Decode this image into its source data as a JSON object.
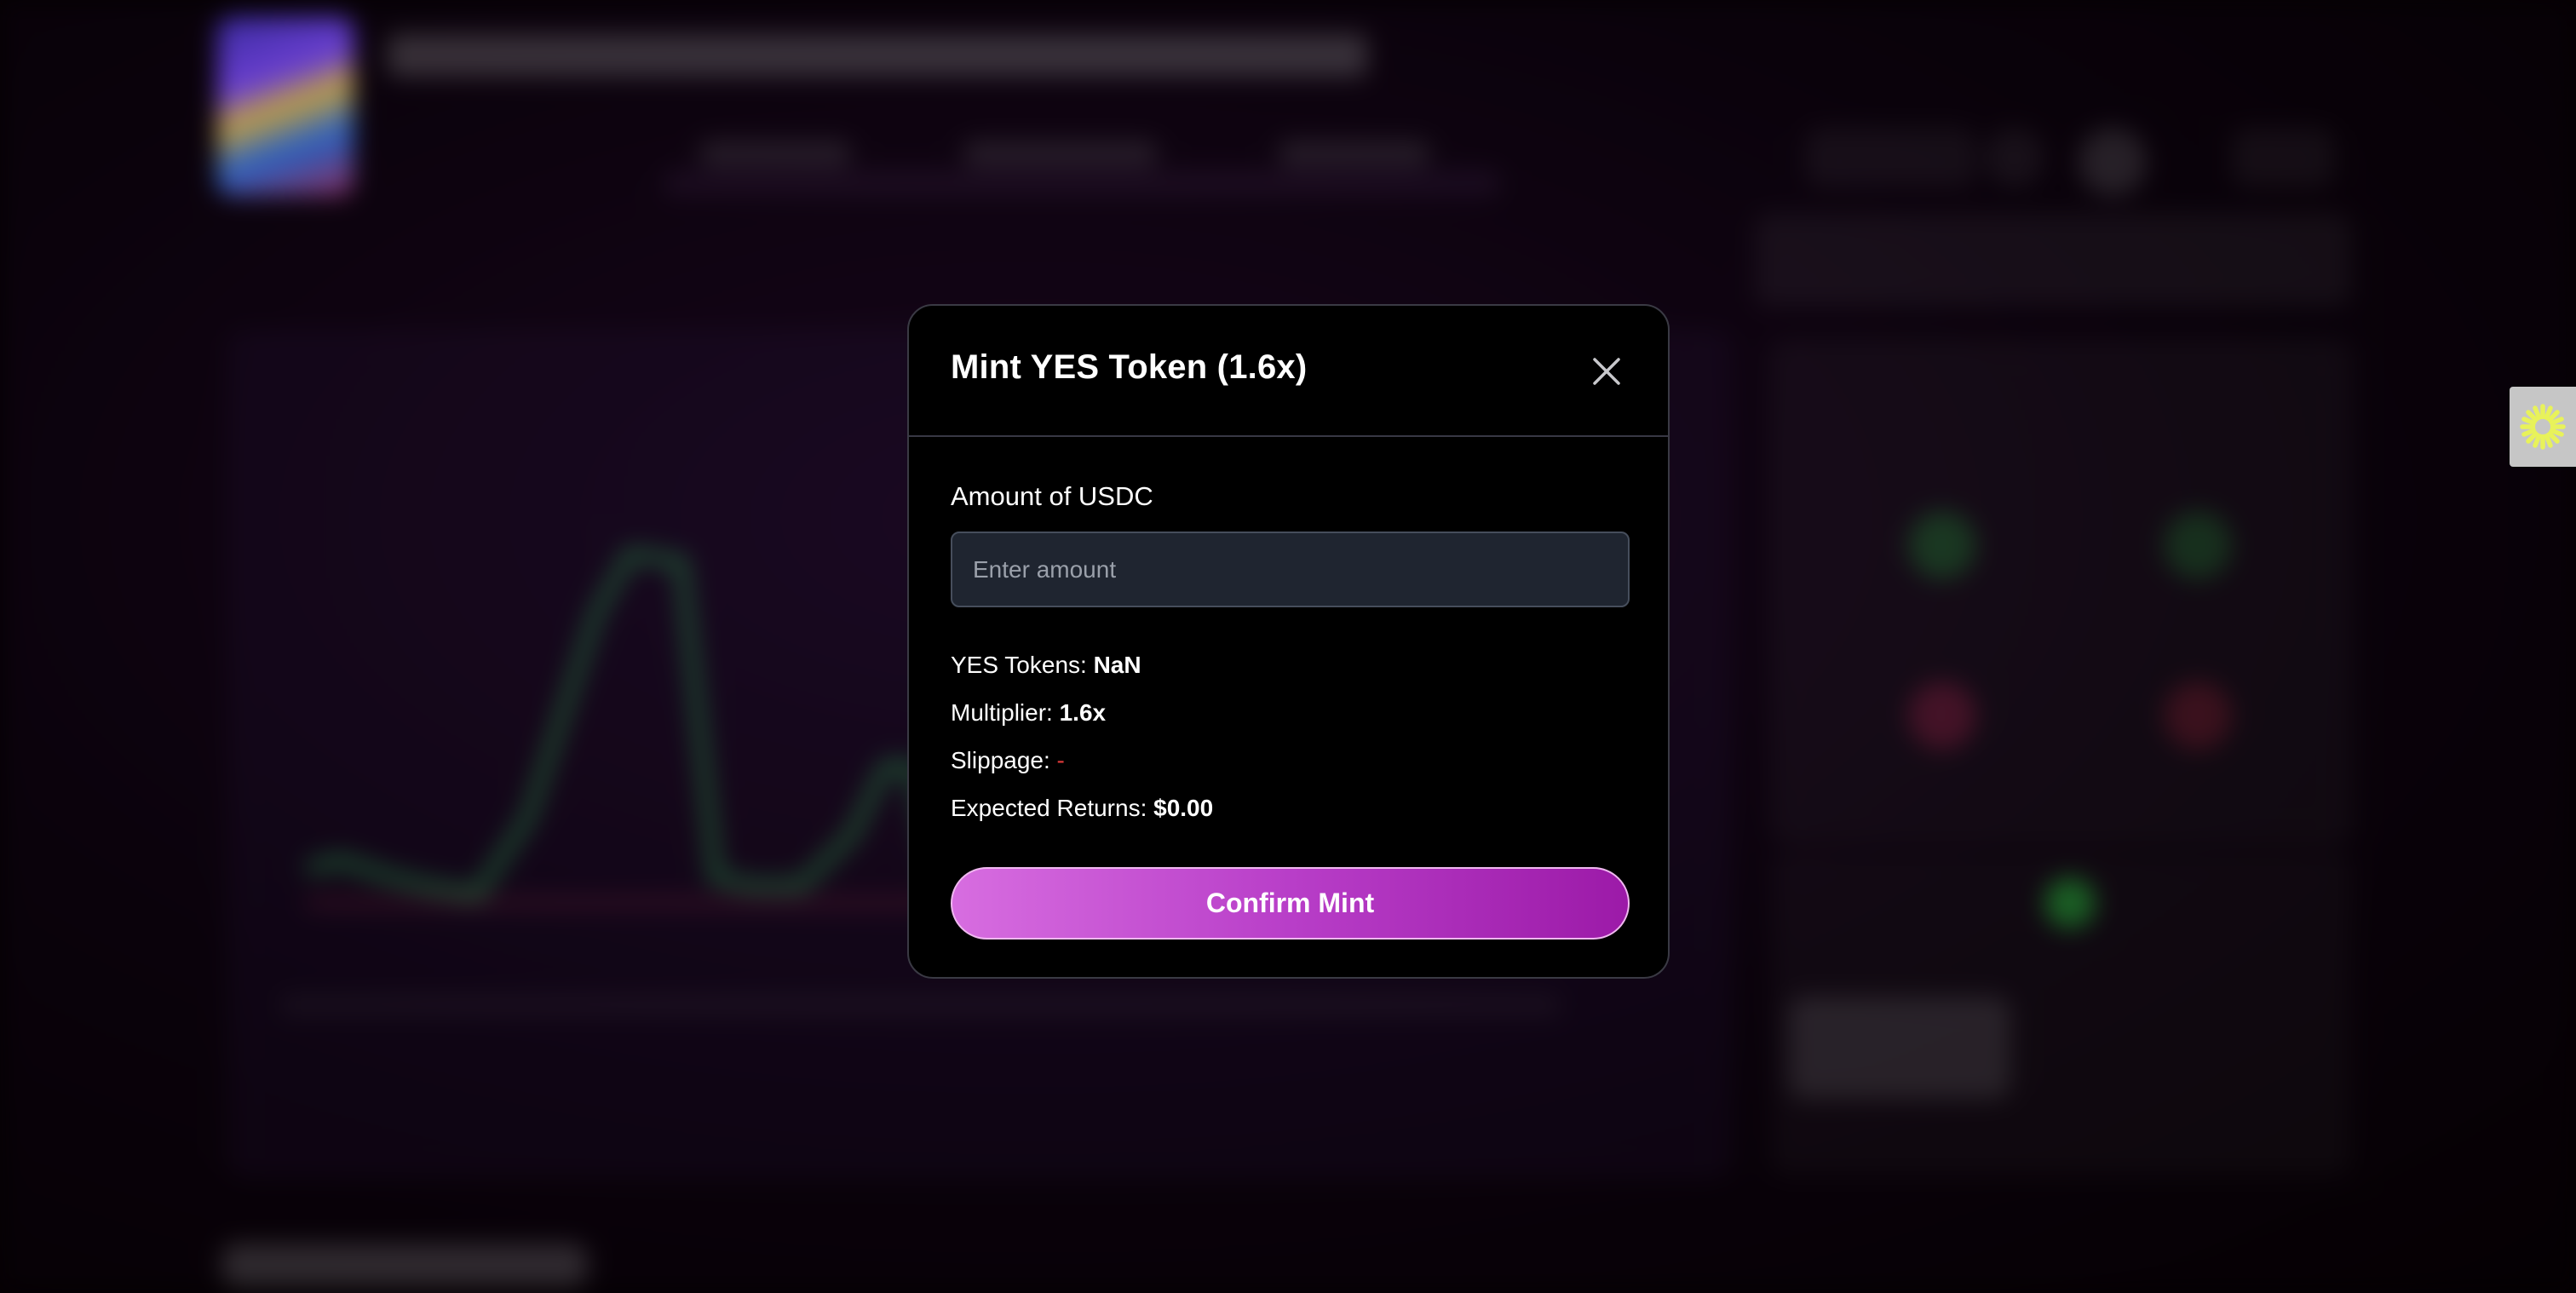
{
  "modal": {
    "title": "Mint YES Token (1.6x)",
    "amount_label": "Amount of USDC",
    "amount_value": "",
    "amount_placeholder": "Enter amount",
    "rows": {
      "yes_tokens": {
        "label": "YES Tokens: ",
        "value": "NaN"
      },
      "multiplier": {
        "label": "Multiplier: ",
        "value": "1.6x"
      },
      "slippage": {
        "label": "Slippage: ",
        "value": "-"
      },
      "expected_returns": {
        "label": "Expected Returns: ",
        "value": "$0.00"
      }
    },
    "confirm_label": "Confirm Mint"
  },
  "icons": {
    "close": "close-icon",
    "helper": "sparkle-icon"
  },
  "colors": {
    "modal_bg": "#000000",
    "input_bg": "#1f2530",
    "button_gradient_start": "#d76de0",
    "button_gradient_end": "#9c1aa8",
    "slippage_value": "#e03a3a",
    "helper_icon": "#e8f25a"
  }
}
